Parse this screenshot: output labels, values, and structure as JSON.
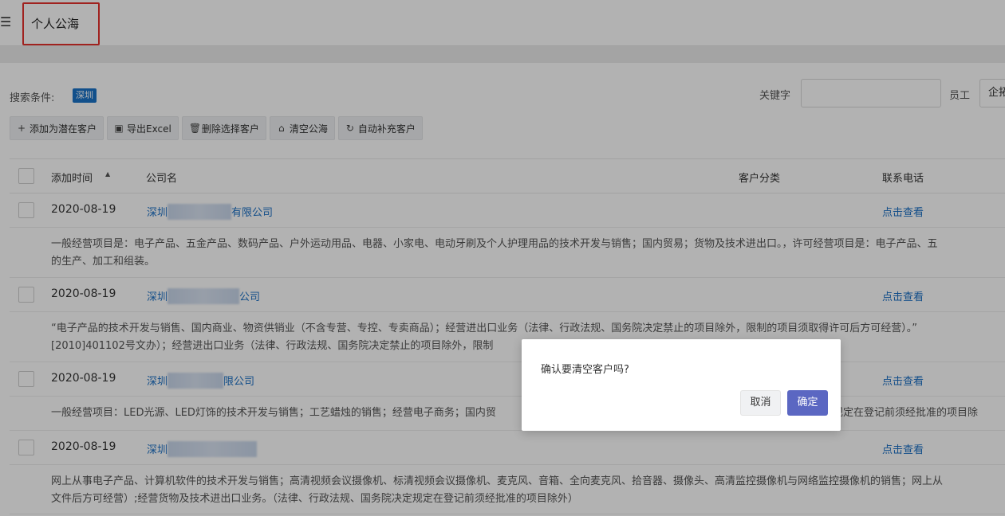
{
  "header": {
    "title": "个人公海",
    "menu_icon": "menu-collapse-icon"
  },
  "filters": {
    "search_label": "搜索条件:",
    "search_tag": "深圳",
    "keyword_label": "关键字",
    "keyword_value": "",
    "employee_label": "员工",
    "employee_value": "企拓"
  },
  "toolbar": [
    {
      "icon": "plus-icon",
      "glyph": "+",
      "label": "添加为潜在客户"
    },
    {
      "icon": "excel-icon",
      "glyph": "▣",
      "label": "导出Excel"
    },
    {
      "icon": "trash-icon",
      "glyph": "🗑",
      "label": "删除选择客户"
    },
    {
      "icon": "basket-icon",
      "glyph": "⌂",
      "label": "清空公海"
    },
    {
      "icon": "refresh-icon",
      "glyph": "↻",
      "label": "自动补充客户"
    }
  ],
  "table": {
    "headers": {
      "date": "添加时间",
      "company": "公司名",
      "category": "客户分类",
      "phone": "联系电话"
    },
    "rows": [
      {
        "date": "2020-08-19",
        "company_prefix": "深圳",
        "company_suffix": "有限公司",
        "phone": "点击查看",
        "desc": "一般经营项目是：电子产品、五金产品、数码产品、户外运动用品、电器、小家电、电动牙刷及个人护理用品的技术开发与销售；国内贸易；货物及技术进出口。，许可经营项目是：电子产品、五\n的生产、加工和组装。"
      },
      {
        "date": "2020-08-19",
        "company_prefix": "深圳",
        "company_suffix": "公司",
        "phone": "点击查看",
        "desc": "“电子产品的技术开发与销售、国内商业、物资供销业（不含专营、专控、专卖商品）；经营进出口业务（法律、行政法规、国务院决定禁止的项目除外，限制的项目须取得许可后方可经营）。”\n[2010]401102号文办）；经营进出口业务（法律、行政法规、国务院决定禁止的项目除外，限制"
      },
      {
        "date": "2020-08-19",
        "company_prefix": "深圳",
        "company_suffix": "限公司",
        "phone": "点击查看",
        "desc": "一般经营项目：LED光源、LED灯饰的技术开发与销售；工艺蜡烛的销售；经营电子商务；国内贸                                                                                                   和规定在登记前须经批准的项目除"
      },
      {
        "date": "2020-08-19",
        "company_prefix": "深圳",
        "company_suffix": "",
        "phone": "点击查看",
        "desc": "网上从事电子产品、计算机软件的技术开发与销售；高清视频会议摄像机、标清视频会议摄像机、麦克风、音箱、全向麦克风、拾音器、摄像头、高清监控摄像机与网络监控摄像机的销售；网上从\n文件后方可经营）;经营货物及技术进出口业务。（法律、行政法规、国务院决定规定在登记前须经批准的项目除外）"
      }
    ]
  },
  "dialog": {
    "message": "确认要清空客户吗?",
    "cancel_label": "取消",
    "ok_label": "确定"
  },
  "colors": {
    "link": "#1a6fc4",
    "primary": "#5b67c2",
    "tag": "#1a73c8",
    "highlight_border": "#e5322d"
  }
}
